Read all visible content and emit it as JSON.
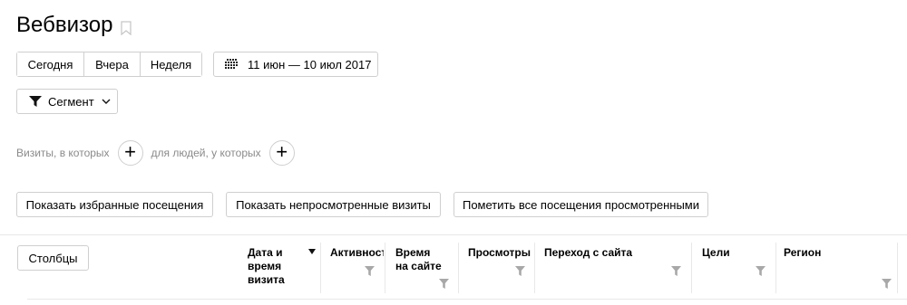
{
  "header": {
    "title": "Вебвизор",
    "bookmark_icon": "bookmark-icon"
  },
  "period": {
    "today": "Сегодня",
    "yesterday": "Вчера",
    "week": "Неделя"
  },
  "date_range": {
    "icon": "calendar-icon",
    "label": "11 июн — 10 июл 2017"
  },
  "segment": {
    "icon": "filter-icon",
    "label": "Сегмент",
    "chevron": "chevron-down-icon"
  },
  "conditions": {
    "visits_label": "Визиты, в которых",
    "people_label": "для людей, у которых",
    "add_symbol": "+"
  },
  "actions": {
    "show_favorites": "Показать избранные посещения",
    "show_unviewed": "Показать непросмотренные визиты",
    "mark_all_viewed": "Пометить все посещения просмотренными"
  },
  "table": {
    "columns_button": "Столбцы",
    "headers": [
      {
        "label": "Дата и\nвремя\nвизита",
        "sorted": "desc"
      },
      {
        "label": "Активность"
      },
      {
        "label": "Время\nна сайте"
      },
      {
        "label": "Просмотры"
      },
      {
        "label": "Переход с сайта"
      },
      {
        "label": "Цели"
      },
      {
        "label": "Регион"
      }
    ]
  },
  "colors": {
    "border": "#cfcfcf",
    "muted_text": "#8a8a8a",
    "icon_gray": "#a8a8a8"
  }
}
